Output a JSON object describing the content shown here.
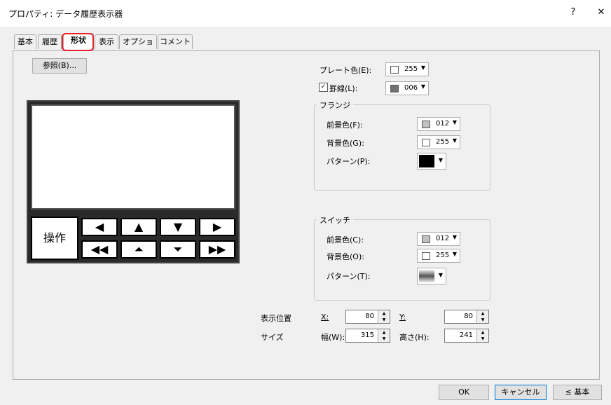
{
  "window": {
    "title": "プロパティ: データ履歴表示器",
    "help_label": "?",
    "close_label": "✕"
  },
  "tabs": [
    {
      "label": "基本"
    },
    {
      "label": "履歴"
    },
    {
      "label": "形状"
    },
    {
      "label": "表示"
    },
    {
      "label": "オプション"
    },
    {
      "label": "コメント"
    }
  ],
  "active_tab": "形状",
  "browse_button": "参照(B)...",
  "preview": {
    "op_button": "操作",
    "nav_row1": [
      "◀",
      "▲",
      "▼",
      "▶"
    ],
    "nav_row2": [
      "◀◀",
      "⏶",
      "⏷",
      "▶▶"
    ]
  },
  "plate": {
    "label": "プレート色(E):",
    "value": "255",
    "color": "#ffffff"
  },
  "border": {
    "label": "罫線(L):",
    "checked": true,
    "value": "006",
    "color": "#707070"
  },
  "flange": {
    "title": "フランジ",
    "fg_label": "前景色(F):",
    "fg_value": "012",
    "fg_color": "#c0c0c0",
    "bg_label": "背景色(G):",
    "bg_value": "255",
    "bg_color": "#ffffff",
    "pattern_label": "パターン(P):"
  },
  "switch": {
    "title": "スイッチ",
    "fg_label": "前景色(C):",
    "fg_value": "012",
    "fg_color": "#c0c0c0",
    "bg_label": "背景色(O):",
    "bg_value": "255",
    "bg_color": "#ffffff",
    "pattern_label": "パターン(T):"
  },
  "position": {
    "label": "表示位置",
    "x_label": "X:",
    "x_value": "80",
    "y_label": "Y:",
    "y_value": "80"
  },
  "size": {
    "label": "サイズ",
    "w_label": "幅(W):",
    "w_value": "315",
    "h_label": "高さ(H):",
    "h_value": "241"
  },
  "footer": {
    "ok": "OK",
    "cancel": "キャンセル",
    "back": "≤ 基本"
  }
}
